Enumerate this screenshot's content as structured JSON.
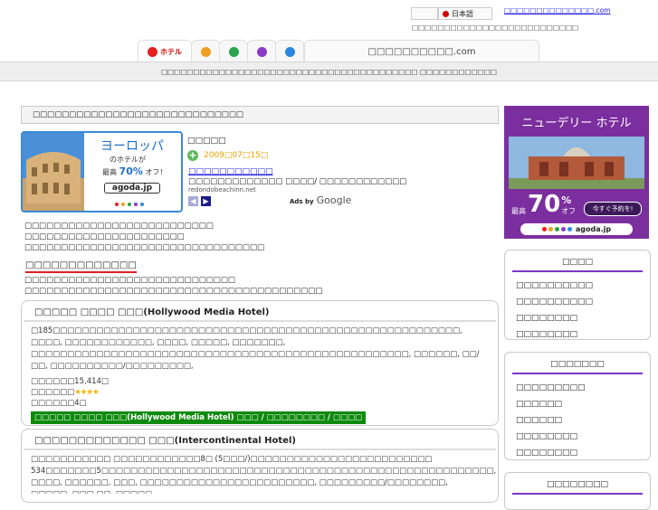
{
  "header": {
    "lang_label": "日本語",
    "top_link": "□□□□□□□□□□□□□□.com",
    "top_text": "□□□□□□□□□□□□□□□□□□□□□□□□□□",
    "site_title": "□□□□□□□□□□.com",
    "tab_hotel_label": "ホテル",
    "nav_text": "□□□□□□□□□□□□□□□□□□□□□□□□□□□□□□□□□□□□□□□□ □□□□□□□□□□□□"
  },
  "main": {
    "section_title": "□□□□□□□□□□□□□□□□□□□□□□□□□□□□□",
    "ad_left": {
      "heading": "ヨーロッパ",
      "line1": "のホテルが",
      "line2_prefix": "最高",
      "line2_pct": "70%",
      "line2_suffix": "オフ！",
      "brand": "agoda.jp"
    },
    "sponsor": {
      "label": "□□□□□",
      "date": "2009□07□15□",
      "link": "□□□□□□□□□□□",
      "text": "□□□□□□□□□□□□□ □□□□/ □□□□□□□□□□□□",
      "url": "redondobeachinn.net",
      "ads_by": "Ads by",
      "google": "Google"
    },
    "intro_lines": [
      "□□□□□□□□□□□□□□□□□□□□□□□□□□",
      "□□□□□□□□□□□□□□□□□□□□□□",
      "□□□□□□□□□□□□□□□□□□□□□□□□□□□□□□□□□"
    ],
    "sub_title": "□□□□□□□□□□□□□",
    "sub_lines": [
      "□□□□□□□□□□□□□□□□□□□□□□□□□□□□□",
      "□□□□□□□□□□□□□□□□□□□□□□□□□□□□□□□□□□□□□□□□□"
    ],
    "hotels": [
      {
        "title": "□□□□□ □□□□ □□□(Hollywood Media Hotel)",
        "desc": "□185□□□□□□□□□□□□□□□□□□□□□□□□□□□□□□□□□□□□□□□□□□□□□□□□□□□□□□□□, □□□□, □□□□□□□□□□□□, □□□□, □□□□□, □□□□□□□, □□□□□□□□□□□□□□□□□□□□□□□□□□□□□□□□□□□□□□□□□□□□□□□□□□□□, □□□□□□, □□/□□, □□□□□□□□□□/□□□□□□□□□, □□□□□□□□□□□□□□□□□□□□□□□□□□□□□□□□□□□□□□□□□□□□□□□□□□□□□□□, □□/□□□□□□□□, □□□□□□□□□□□□□□□□□□□□□□□□□□□□□□□□□□□□□□□□□□□□□□□□□□□□□□□□□□□□□□□□□□□□ □□□□□□□□□□□□□□□ □□□ □□□□□□□□□□□□□□□□□□□□□□□□□□□□□□□□□□□□□□□□□□□□□□□□□□□□□□□□□□□□□□□□□",
        "price": "□□□□□□15,414□",
        "rating_label": "□□□□□□",
        "stars": "★★★★",
        "rooms": "□□□□□□4□",
        "bar": "□□□□□ □□□□ □□□(Hollywood Media Hotel) □□□ / □□□□□□□□ / □□□□"
      },
      {
        "title": "□□□□□□□□□□□□□ □□□(Intercontinental Hotel)",
        "desc": "□□□□□□□□□□□ □□□□□□□□□□□□8□ (5□□□/)□□□□□□□□□□□□□□□□□□□□□□□□□ 534□□□□□□□5□□□□□□□□□□□□□□□□□□□□□□□□□□□□□□□□□□□□□□□□□□□□□□□□□□□□□□, □□□□, □□□□□□, □□□, □□□□□□□□□□□□□□□□□□□□□□□□, □□□□□□□□□/□□□□□□□□, □□□□□, □□□ □□, □□□□□, □□□□□□□□□□□□□□□□□□□□□□□□□□□□□□□□□□□□□□□□□□□□□□□□□□□□□□□□□□□□□□□□□□□□□□□□□□, □□/□□□□□□□□, □□□□□□□□□□□□□□□□□□□□□□□□□□□□□□□□□□□□□□□□□□□□□□□□□□□□□□□□□□□□□□□□ □□□ □□□□□□□□□□□□□□□□□□□□□□□□□□□□□□□□□□□□□□□□□□"
      }
    ]
  },
  "sidebar": {
    "banner": {
      "title": "ニューデリー ホテル",
      "prefix": "最高",
      "pct": "70",
      "pct_sign": "%",
      "off": "オフ",
      "cta": "今すぐ予約を!",
      "brand": "agoda.jp"
    },
    "box1": {
      "title": "□□□□",
      "items": [
        "□□□□□□□□□□",
        "□□□□□□□□□□",
        "□□□□□□□□",
        "□□□□□□□□"
      ]
    },
    "box2": {
      "title": "□□□□□□□",
      "items": [
        "□□□□□□□□□",
        "□□□□□□",
        "□□□□□□",
        "□□□□□□□□",
        "□□□□□□□□"
      ]
    },
    "box3": {
      "title": "□□□□□□□□"
    }
  },
  "colors": {
    "accent_purple": "#7b36c4",
    "green_bar": "#0e8a0e",
    "link_blue": "#1a1ae6",
    "gold": "#f2b300"
  }
}
